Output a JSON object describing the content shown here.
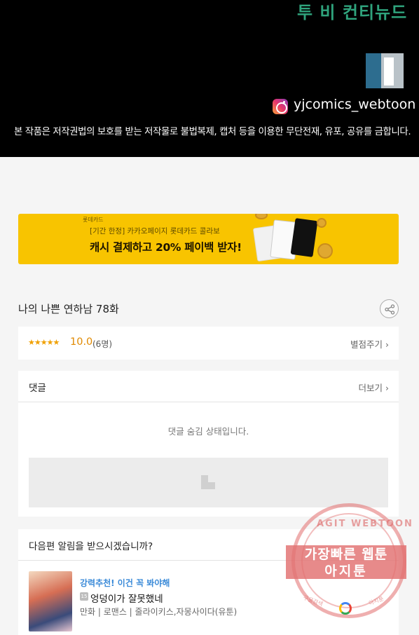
{
  "hero": {
    "title": "투 비 컨티뉴드",
    "instagram_handle": "yjcomics_webtoon",
    "copyright": "본 작품은 저작권법의 보호를 받는 저작물로 불법복제, 캡처 등을 이용한 무단전재, 유포, 공유를 금합니다."
  },
  "banner": {
    "brand": "롯데카드",
    "subtitle": "[기간 한정] 카카오페이지 롯데카드 콜라보",
    "headline": "캐시 결제하고 20% 페이백 받자!",
    "background_color": "#f8c400"
  },
  "episode": {
    "title": "나의 나쁜 연하남 78화"
  },
  "rating": {
    "stars": "★★★★★",
    "score": "10.0",
    "count": "(6명)",
    "rate_link": "별점주기 ›"
  },
  "comments": {
    "label": "댓글",
    "more": "더보기 ›",
    "hidden_message": "댓글 숨김 상태입니다."
  },
  "notify": {
    "question": "다음편 알림을 받으시겠습니까?",
    "recommend_label": "강력추천! 이건 꼭 봐야해",
    "age_badge": "15",
    "work_title": "엉덩이가 잘못했네",
    "meta": "만화 | 로맨스 | 줄라이키스,자몽사이다(유툰)"
  },
  "watermark": {
    "arc_text": "AGIT WEBTOON",
    "line1": "가장빠른 웹툰",
    "line2": "아지툰",
    "small_left": "구글검색",
    "small_right": "아지툰"
  }
}
